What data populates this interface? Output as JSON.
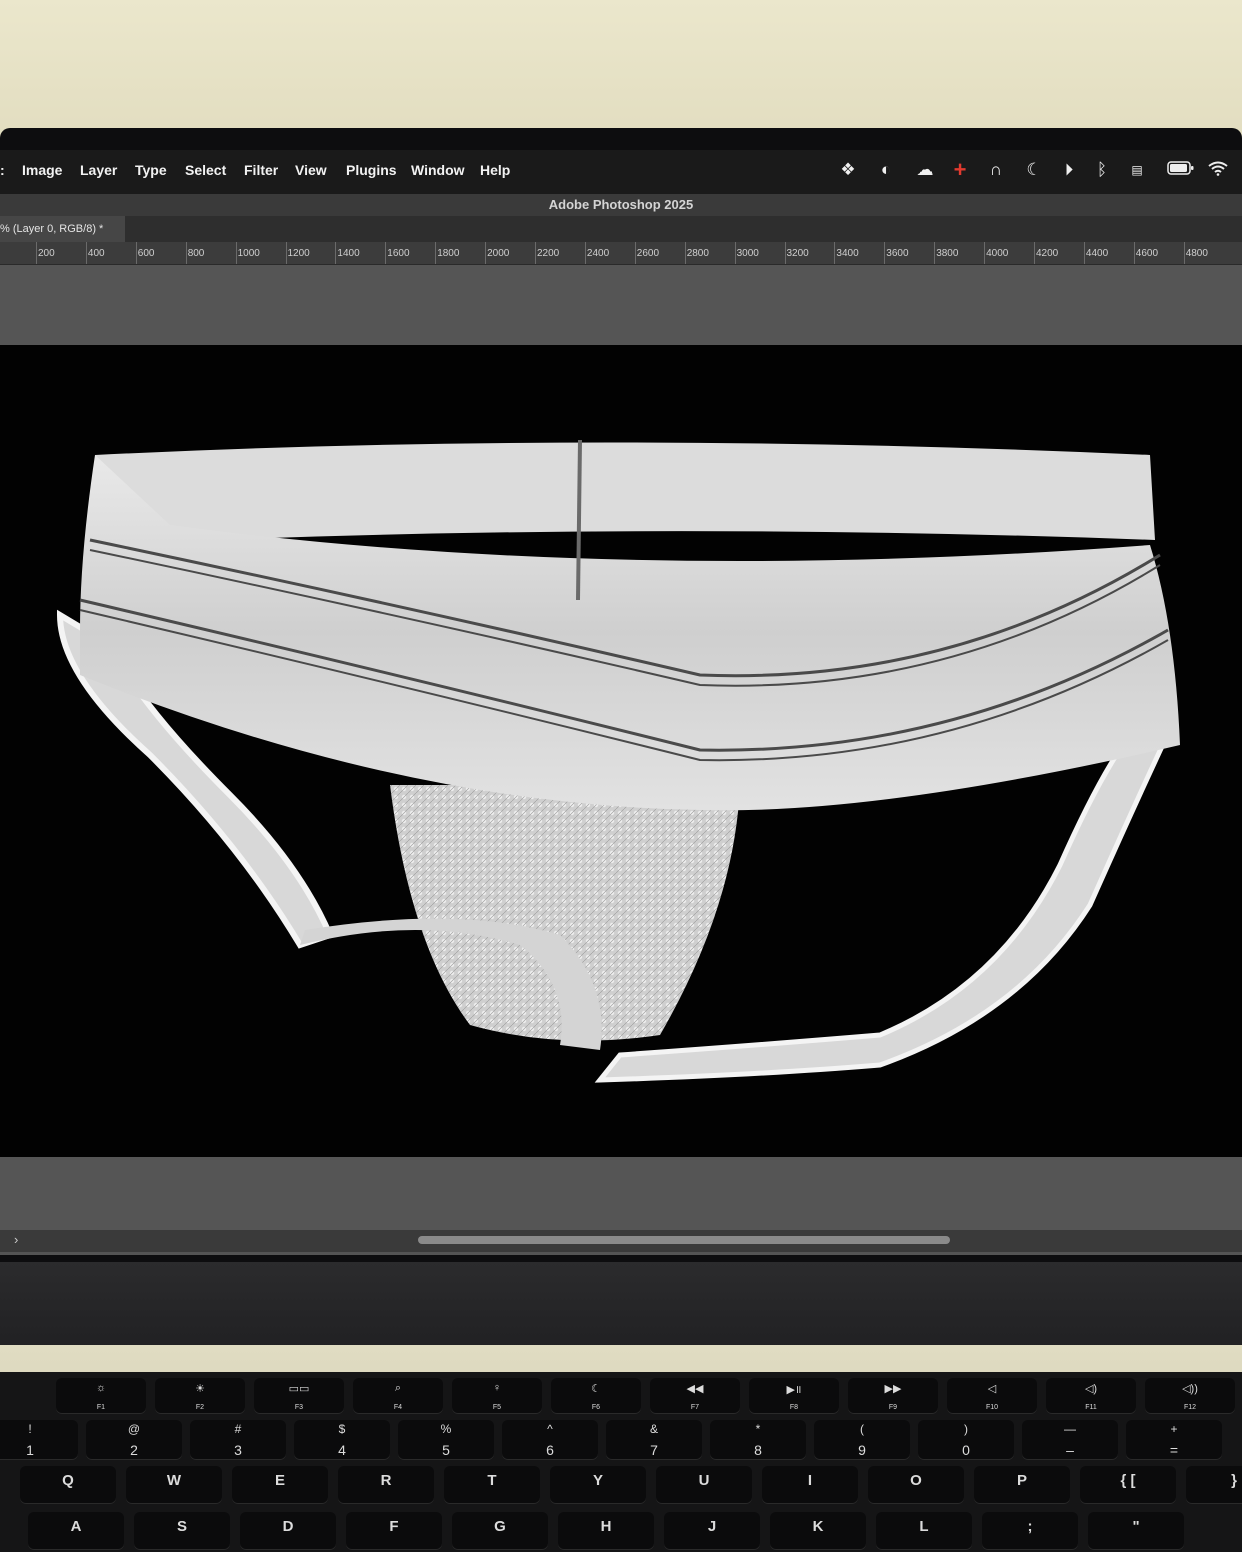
{
  "menubar": {
    "items": [
      "Image",
      "Layer",
      "Type",
      "Select",
      "Filter",
      "View",
      "Plugins",
      "Window",
      "Help"
    ],
    "status_icons": [
      "dropbox-icon",
      "color-picker-icon",
      "creative-cloud-icon",
      "plus-cross-icon",
      "headphones-icon",
      "moon-icon",
      "play-circle-icon",
      "bluetooth-icon",
      "keyboard-layout-icon",
      "battery-icon",
      "wifi-icon"
    ]
  },
  "window": {
    "title": "Adobe Photoshop 2025"
  },
  "document": {
    "tab_label": "% (Layer 0, RGB/8) *"
  },
  "ruler": {
    "ticks": [
      "200",
      "400",
      "600",
      "800",
      "1000",
      "1200",
      "1400",
      "1600",
      "1800",
      "2000",
      "2200",
      "2400",
      "2600",
      "2800",
      "3000",
      "3200",
      "3400",
      "3600",
      "3800",
      "4000",
      "4200",
      "4400",
      "4600",
      "4800"
    ]
  },
  "keyboard": {
    "fkeys": [
      {
        "icon": "☼",
        "label": "F1"
      },
      {
        "icon": "☀",
        "label": "F2"
      },
      {
        "icon": "▭▭",
        "label": "F3"
      },
      {
        "icon": "⌕",
        "label": "F4"
      },
      {
        "icon": "♀",
        "label": "F5"
      },
      {
        "icon": "☾",
        "label": "F6"
      },
      {
        "icon": "◀◀",
        "label": "F7"
      },
      {
        "icon": "▶॥",
        "label": "F8"
      },
      {
        "icon": "▶▶",
        "label": "F9"
      },
      {
        "icon": "◁",
        "label": "F10"
      },
      {
        "icon": "◁)",
        "label": "F11"
      },
      {
        "icon": "◁))",
        "label": "F12"
      }
    ],
    "numbers": [
      {
        "top": "!",
        "bottom": "1"
      },
      {
        "top": "@",
        "bottom": "2"
      },
      {
        "top": "#",
        "bottom": "3"
      },
      {
        "top": "$",
        "bottom": "4"
      },
      {
        "top": "%",
        "bottom": "5"
      },
      {
        "top": "^",
        "bottom": "6"
      },
      {
        "top": "&",
        "bottom": "7"
      },
      {
        "top": "*",
        "bottom": "8"
      },
      {
        "top": "(",
        "bottom": "9"
      },
      {
        "top": ")",
        "bottom": "0"
      },
      {
        "top": "—",
        "bottom": "–"
      },
      {
        "top": "+",
        "bottom": "="
      }
    ],
    "row_q": [
      "Q",
      "W",
      "E",
      "R",
      "T",
      "Y",
      "U",
      "I",
      "O",
      "P",
      "{ [",
      "}"
    ],
    "row_a": [
      "A",
      "S",
      "D",
      "F",
      "G",
      "H",
      "J",
      "K",
      "L",
      ";",
      "\""
    ]
  }
}
